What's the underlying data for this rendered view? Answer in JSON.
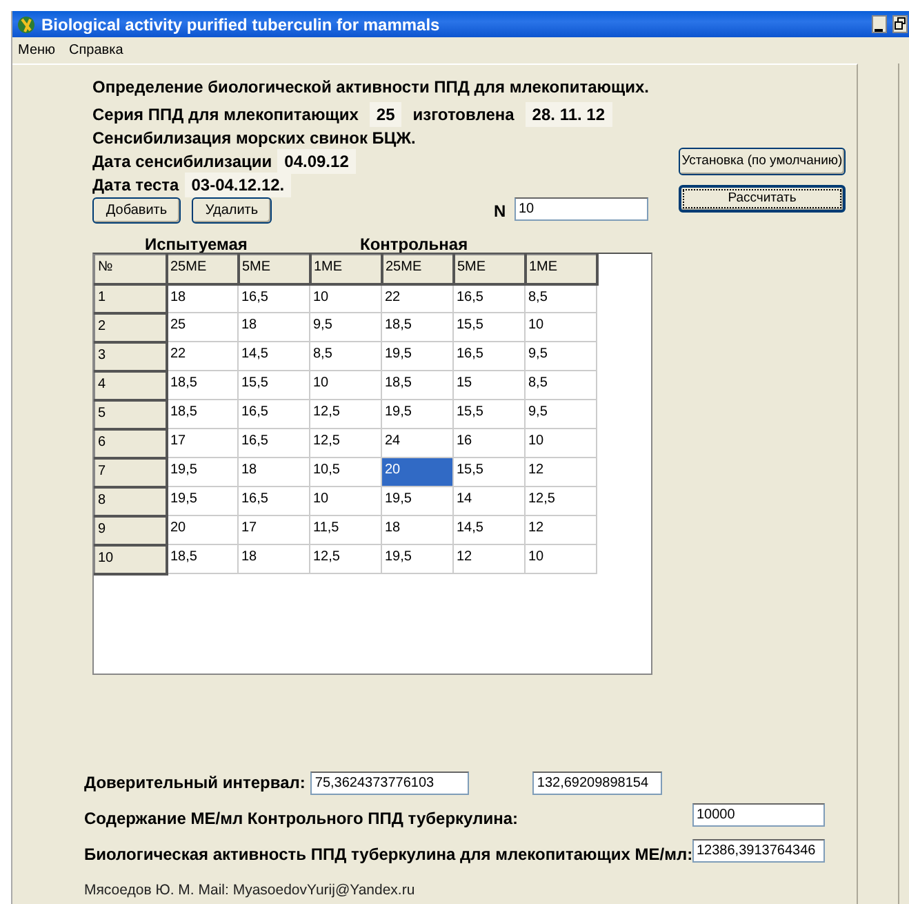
{
  "window": {
    "title": "Biological activity purified tuberculin for mammals"
  },
  "menu": [
    "Меню",
    "Справка"
  ],
  "heading": "Определение биологической активности ППД для млекопитающих.",
  "info": [
    {
      "label": "Серия ППД для млекопитающих",
      "value": "25"
    },
    {
      "label": "изготовлена",
      "value": "28. 11. 12"
    }
  ],
  "sensitization": "Сенсибилизация морских свинок БЦЖ.",
  "dates": [
    {
      "label": "Дата сенсибилизации",
      "value": "04.09.12"
    },
    {
      "label": "Дата теста",
      "value": "03-04.12.12."
    }
  ],
  "buttons": [
    "Добавить",
    "Удалить"
  ],
  "n_field": {
    "label": "N",
    "value": "10"
  },
  "side_buttons": [
    {
      "label": "Установка (по умолчанию)",
      "focused": false
    },
    {
      "label": "Рассчитать",
      "focused": true
    }
  ],
  "table": {
    "groups": [
      "Испытуемая",
      "Контрольная"
    ],
    "row_header_title": "№",
    "columns": [
      "25МЕ",
      "5МЕ",
      "1МЕ",
      "25МЕ",
      "5МЕ",
      "1МЕ"
    ],
    "rows": [
      {
        "number": "1",
        "cells": [
          {
            "text": "18",
            "selected": false
          },
          {
            "text": "16,5",
            "selected": false
          },
          {
            "text": "10",
            "selected": false
          },
          {
            "text": "22",
            "selected": false
          },
          {
            "text": "16,5",
            "selected": false
          },
          {
            "text": "8,5",
            "selected": false
          }
        ]
      },
      {
        "number": "2",
        "cells": [
          {
            "text": "25",
            "selected": false
          },
          {
            "text": "18",
            "selected": false
          },
          {
            "text": "9,5",
            "selected": false
          },
          {
            "text": "18,5",
            "selected": false
          },
          {
            "text": "15,5",
            "selected": false
          },
          {
            "text": "10",
            "selected": false
          }
        ]
      },
      {
        "number": "3",
        "cells": [
          {
            "text": "22",
            "selected": false
          },
          {
            "text": "14,5",
            "selected": false
          },
          {
            "text": "8,5",
            "selected": false
          },
          {
            "text": "19,5",
            "selected": false
          },
          {
            "text": "16,5",
            "selected": false
          },
          {
            "text": "9,5",
            "selected": false
          }
        ]
      },
      {
        "number": "4",
        "cells": [
          {
            "text": "18,5",
            "selected": false
          },
          {
            "text": "15,5",
            "selected": false
          },
          {
            "text": "10",
            "selected": false
          },
          {
            "text": "18,5",
            "selected": false
          },
          {
            "text": "15",
            "selected": false
          },
          {
            "text": "8,5",
            "selected": false
          }
        ]
      },
      {
        "number": "5",
        "cells": [
          {
            "text": "18,5",
            "selected": false
          },
          {
            "text": "16,5",
            "selected": false
          },
          {
            "text": "12,5",
            "selected": false
          },
          {
            "text": "19,5",
            "selected": false
          },
          {
            "text": "15,5",
            "selected": false
          },
          {
            "text": "9,5",
            "selected": false
          }
        ]
      },
      {
        "number": "6",
        "cells": [
          {
            "text": "17",
            "selected": false
          },
          {
            "text": "16,5",
            "selected": false
          },
          {
            "text": "12,5",
            "selected": false
          },
          {
            "text": "24",
            "selected": false
          },
          {
            "text": "16",
            "selected": false
          },
          {
            "text": "10",
            "selected": false
          }
        ]
      },
      {
        "number": "7",
        "cells": [
          {
            "text": "19,5",
            "selected": false
          },
          {
            "text": "18",
            "selected": false
          },
          {
            "text": "10,5",
            "selected": false
          },
          {
            "text": "20",
            "selected": true
          },
          {
            "text": "15,5",
            "selected": false
          },
          {
            "text": "12",
            "selected": false
          }
        ]
      },
      {
        "number": "8",
        "cells": [
          {
            "text": "19,5",
            "selected": false
          },
          {
            "text": "16,5",
            "selected": false
          },
          {
            "text": "10",
            "selected": false
          },
          {
            "text": "19,5",
            "selected": false
          },
          {
            "text": "14",
            "selected": false
          },
          {
            "text": "12,5",
            "selected": false
          }
        ]
      },
      {
        "number": "9",
        "cells": [
          {
            "text": "20",
            "selected": false
          },
          {
            "text": "17",
            "selected": false
          },
          {
            "text": "11,5",
            "selected": false
          },
          {
            "text": "18",
            "selected": false
          },
          {
            "text": "14,5",
            "selected": false
          },
          {
            "text": "12",
            "selected": false
          }
        ]
      },
      {
        "number": "10",
        "cells": [
          {
            "text": "18,5",
            "selected": false
          },
          {
            "text": "18",
            "selected": false
          },
          {
            "text": "12,5",
            "selected": false
          },
          {
            "text": "19,5",
            "selected": false
          },
          {
            "text": "12",
            "selected": false
          },
          {
            "text": "10",
            "selected": false
          }
        ]
      }
    ]
  },
  "confidence": {
    "label": "Доверительный интервал:",
    "low": "75,3624373776103",
    "high": "132,69209898154"
  },
  "content": {
    "label": "Содержание МЕ/мл Контрольного ППД туберкулина:",
    "value": "10000"
  },
  "activity": {
    "label": "Биологическая активность ППД туберкулина для млекопитающих МЕ/мл:",
    "value": "12386,3913764346"
  },
  "author": "Мясоедов Ю. М. Mail:  MyasoedovYurij@Yandex.ru"
}
